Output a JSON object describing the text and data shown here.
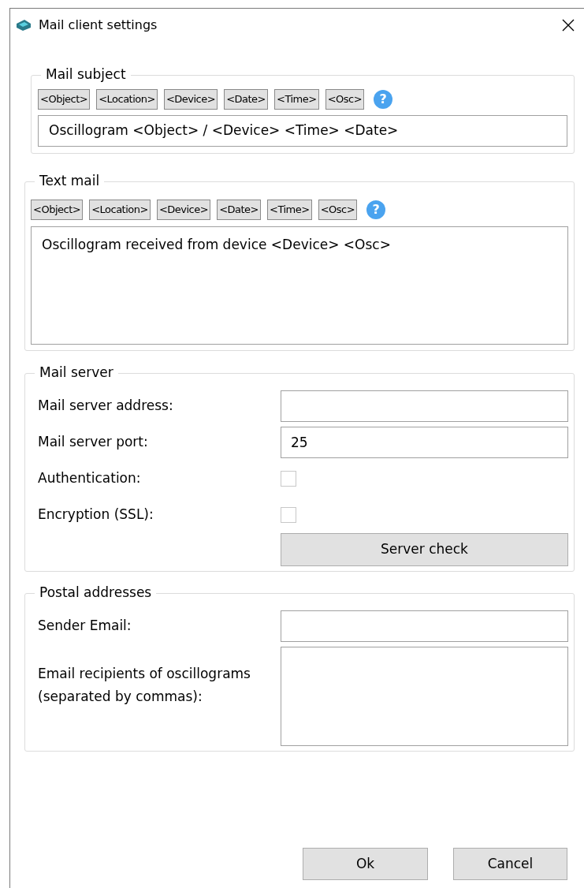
{
  "window": {
    "title": "Mail client settings"
  },
  "subject": {
    "legend": "Mail subject",
    "tags": [
      "<Object>",
      "<Location>",
      "<Device>",
      "<Date>",
      "<Time>",
      "<Osc>"
    ],
    "help": "?",
    "value": "Oscillogram <Object> / <Device> <Time> <Date>"
  },
  "text_mail": {
    "legend": "Text mail",
    "tags": [
      "<Object>",
      "<Location>",
      "<Device>",
      "<Date>",
      "<Time>",
      "<Osc>"
    ],
    "help": "?",
    "value": "Oscillogram received from device <Device> <Osc>"
  },
  "mail_server": {
    "legend": "Mail server",
    "rows": [
      {
        "kind": "input",
        "label": "Mail server address:"
      },
      {
        "kind": "input",
        "label": "Mail server port:",
        "value": "25"
      },
      {
        "kind": "checkbox",
        "label": "Authentication:",
        "checked": false
      },
      {
        "kind": "checkbox",
        "label": "Encryption (SSL):",
        "checked": false
      }
    ],
    "button": "Server check"
  },
  "postal": {
    "legend": "Postal addresses",
    "rows": [
      {
        "kind": "input",
        "label": "Sender Email:"
      },
      {
        "kind": "textarea",
        "label": "Email recipients of oscillograms (separated by commas):"
      }
    ]
  },
  "buttons": [
    "Ok",
    "Cancel"
  ]
}
